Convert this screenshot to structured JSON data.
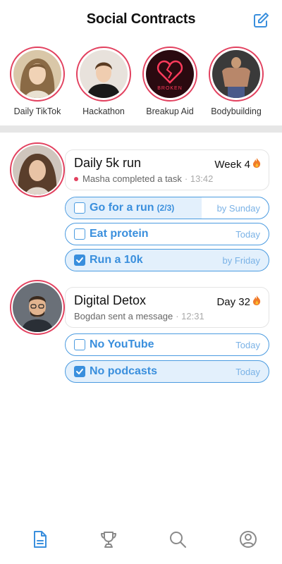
{
  "header": {
    "title": "Social Contracts",
    "compose_icon": "compose-icon"
  },
  "stories": [
    {
      "label": "Daily TikTok"
    },
    {
      "label": "Hackathon"
    },
    {
      "label": "Breakup Aid",
      "image_text": "BROKEN"
    },
    {
      "label": "Bodybuilding"
    }
  ],
  "contracts": [
    {
      "title": "Daily 5k run",
      "badge": "Week 4",
      "badge_icon": "fire-icon",
      "activity": "Masha completed a task",
      "time": "· 13:42",
      "unread": true,
      "tasks": [
        {
          "label": "Go for a run",
          "progress_text": "(2/3)",
          "progress": 0.67,
          "due": "by Sunday",
          "checked": false
        },
        {
          "label": "Eat protein",
          "due": "Today",
          "checked": false
        },
        {
          "label": "Run a 10k",
          "due": "by Friday",
          "checked": true
        }
      ]
    },
    {
      "title": "Digital Detox",
      "badge": "Day 32",
      "badge_icon": "fire-icon",
      "activity": "Bogdan sent a message",
      "time": "· 12:31",
      "unread": false,
      "tasks": [
        {
          "label": "No YouTube",
          "due": "Today",
          "checked": false
        },
        {
          "label": "No podcasts",
          "due": "Today",
          "checked": true
        }
      ]
    }
  ],
  "nav": [
    {
      "icon": "contracts-icon",
      "active": true
    },
    {
      "icon": "trophy-icon",
      "active": false
    },
    {
      "icon": "search-icon",
      "active": false
    },
    {
      "icon": "profile-icon",
      "active": false
    }
  ],
  "colors": {
    "accent": "#3a8fdd",
    "ring": "#e2415f",
    "divider": "#e6e6e6"
  }
}
